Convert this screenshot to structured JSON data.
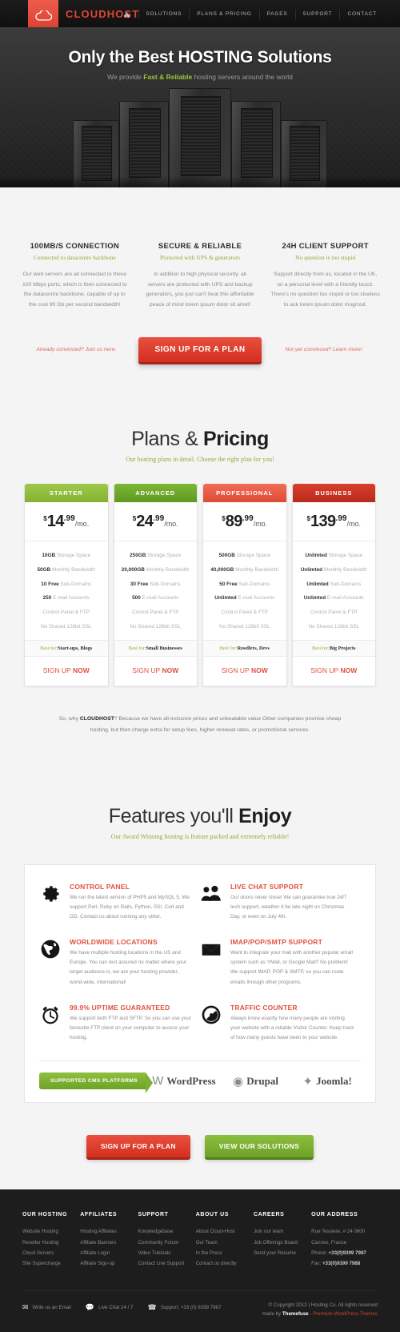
{
  "header": {
    "brand": "CLOUDHOST",
    "logo_icon": "cloud-icon",
    "home_icon": "home-icon",
    "nav": [
      {
        "label": "SOLUTIONS"
      },
      {
        "label": "PLANS & PRICING"
      },
      {
        "label": "PAGES"
      },
      {
        "label": "SUPPORT"
      },
      {
        "label": "CONTACT"
      }
    ]
  },
  "hero": {
    "title_light": "Only the Best ",
    "title_bold": "HOSTING Solutions",
    "sub_pre": "We provide ",
    "sub_hl": "Fast & Reliable",
    "sub_post": " hosting servers around the world"
  },
  "intro": {
    "columns": [
      {
        "title": "100MB/S CONNECTION",
        "tagline": "Connected to datacentre backbone",
        "body": "Our web servers are all connected to these 100 Mbps ports, which is then connected to the datacentre backbone, capable of up to the cool 90 Gb per second bandwidth!"
      },
      {
        "title": "SECURE & RELIABLE",
        "tagline": "Protected with UPS & generators",
        "body": "In addition to high physical security, all servers are protected with UPS and backup generators, you just can't beat this affordable peace of mind lorem ipsum dolor sit amet!"
      },
      {
        "title": "24H CLIENT SUPPORT",
        "tagline": "No question is too stupid",
        "body": "Support directly from us, located in the UK, on a personal level with a friendly touch. There's no question too stupid or too clueless to ask lorem ipsum dolor mogrosit."
      }
    ],
    "left_note": "Already convinced? Join us here:",
    "cta_label": "SIGN UP FOR A PLAN",
    "right_note": "Not yet convinced? Learn more!"
  },
  "plans": {
    "title_light": "Plans & ",
    "title_bold": "Pricing",
    "subtitle": "Our hosting plans in detail. Choose the right plan for you!",
    "items": [
      {
        "name": "STARTER",
        "currency": "$",
        "price": "14",
        "cents": ".99",
        "period": "/mo.",
        "features": [
          {
            "strong": "10GB",
            "rest": " Storage Space"
          },
          {
            "strong": "50GB",
            "rest": " Monthly Bandwidth"
          },
          {
            "strong": "10 Free",
            "rest": " Sub-Domains"
          },
          {
            "strong": "250",
            "rest": " E-mail Accounts"
          },
          {
            "strong": "",
            "rest": "Control Panel & FTP"
          },
          {
            "strong": "",
            "rest": "No Shared 128bit SSL"
          }
        ],
        "best_label": "Best for:",
        "best_value": "Start-ups, Blogs",
        "cta_light": "SIGN UP ",
        "cta_bold": "NOW"
      },
      {
        "name": "ADVANCED",
        "currency": "$",
        "price": "24",
        "cents": ".99",
        "period": "/mo.",
        "features": [
          {
            "strong": "250GB",
            "rest": " Storage Space"
          },
          {
            "strong": "20,000GB",
            "rest": " Monthly Bandwidth"
          },
          {
            "strong": "30 Free",
            "rest": " Sub-Domains"
          },
          {
            "strong": "500",
            "rest": " E-mail Accounts"
          },
          {
            "strong": "",
            "rest": "Control Panel & FTP"
          },
          {
            "strong": "",
            "rest": "No Shared 128bit SSL"
          }
        ],
        "best_label": "Best for:",
        "best_value": "Small Businesses",
        "cta_light": "SIGN UP ",
        "cta_bold": "NOW"
      },
      {
        "name": "PROFESSIONAL",
        "currency": "$",
        "price": "89",
        "cents": ".99",
        "period": "/mo.",
        "features": [
          {
            "strong": "500GB",
            "rest": " Storage Space"
          },
          {
            "strong": "40,000GB",
            "rest": " Monthly Bandwidth"
          },
          {
            "strong": "50 Free",
            "rest": " Sub-Domains"
          },
          {
            "strong": "Unlimted",
            "rest": " E-mail Accounts"
          },
          {
            "strong": "",
            "rest": "Control Panel & FTP"
          },
          {
            "strong": "",
            "rest": "No Shared 128bit SSL"
          }
        ],
        "best_label": "Best for:",
        "best_value": "Resellers, Devs",
        "cta_light": "SIGN UP ",
        "cta_bold": "NOW"
      },
      {
        "name": "BUSINESS",
        "currency": "$",
        "price": "139",
        "cents": ".99",
        "period": "/mo.",
        "features": [
          {
            "strong": "Unlimted",
            "rest": " Storage Space"
          },
          {
            "strong": "Unlimted",
            "rest": " Monthly Bandwidth"
          },
          {
            "strong": "Unlimted",
            "rest": " Sub-Domains"
          },
          {
            "strong": "Unlimted",
            "rest": " E-mail Accounts"
          },
          {
            "strong": "",
            "rest": "Control Panel & FTP"
          },
          {
            "strong": "",
            "rest": "No Shared 128bit SSL"
          }
        ],
        "best_label": "Best for:",
        "best_value": "Big Projects",
        "cta_light": "SIGN UP ",
        "cta_bold": "NOW"
      }
    ],
    "note_pre": "So, why ",
    "note_brand": "CLOUDHOST",
    "note_post": "? Because we have all-inclusive prices and unbeatable value Other companies promise cheap hosting, but then charge extra for setup fees, higher renewal rates, or promotional services."
  },
  "features": {
    "title_light": "Features you'll ",
    "title_bold": "Enjoy",
    "subtitle": "Our Award Winning hosting is feature packed and extremely reliable!",
    "items": [
      {
        "icon": "gear-icon",
        "title": "CONTROL PANEL",
        "body": "We run the latest version of PHP5 and MySQL 5. We support Perl, Ruby on Rails, Python, SSI, Curl and GD. Contact us about running any other."
      },
      {
        "icon": "people-chat-icon",
        "title": "LIVE CHAT SUPPORT",
        "body": "Our doors never close! We can guarantee true 24/7 tech support, weather it be late night on Christmas Day, or even on July 4th."
      },
      {
        "icon": "globe-icon",
        "title": "WORLDWIDE LOCATIONS",
        "body": "We have multiple hosting locations in the US and Europe. You can rest assured no matter where your target audience is, we are your hosting provider, world-wide, international!"
      },
      {
        "icon": "envelope-icon",
        "title": "IMAP/POP/SMTP SUPPORT",
        "body": "Want to integrate your mail with another popular email system such as YMail, or Google Mail? No problem! We support IMAP, POP & SMTP, so you can route emails through other programs."
      },
      {
        "icon": "alarm-clock-icon",
        "title": "99.9% UPTIME GUARANTEED",
        "body": "We support both FTP and SFTP. So you can use your favourite FTP client on your computer to access your hosting."
      },
      {
        "icon": "traffic-counter-icon",
        "title": "TRAFFIC COUNTER",
        "body": "Always know exactly how many people are visiting your website with a reliable Visitor Counter. Keep track of how many guests have been to your website."
      }
    ],
    "cms_badge": "SUPPORTED CMS PLATFORMS",
    "cms_platforms": [
      {
        "name": "WordPress",
        "mark": "W"
      },
      {
        "name": "Drupal",
        "mark": "◉"
      },
      {
        "name": "Joomla!",
        "mark": "✦"
      }
    ]
  },
  "bottom_cta": {
    "primary": "SIGN UP FOR A PLAN",
    "secondary": "VIEW OUR SOLUTIONS"
  },
  "footer": {
    "columns": [
      {
        "title": "OUR HOSTING",
        "links": [
          "Website Hosting",
          "Reseller Hosting",
          "Cloud Servers",
          "Site Supercharge"
        ]
      },
      {
        "title": "AFFILIATES",
        "links": [
          "Hosting Affiliates",
          "Affiliate Banners",
          "Affiliate Login",
          "Affiliate Sign-up"
        ]
      },
      {
        "title": "SUPPORT",
        "links": [
          "Knowledgebase",
          "Community Forum",
          "Video Tutorials",
          "Contact Live Support"
        ]
      },
      {
        "title": "ABOUT US",
        "links": [
          "About Cloud-Host",
          "Our Team",
          "In the Press",
          "Contact us directly"
        ]
      },
      {
        "title": "CAREERS",
        "links": [
          "Join our team",
          "Job Offerings Board",
          "Send your Resume"
        ]
      }
    ],
    "address": {
      "title": "OUR ADDRESS",
      "line1": "Rue Tessiere, # 24 0600",
      "line2": "Cannes, France",
      "phone_label": "Phone: ",
      "phone_value": "+33(0)9399 7987",
      "fax_label": "Fax: ",
      "fax_value": "+33(0)9399 7988"
    },
    "contacts": [
      {
        "icon": "envelope-icon",
        "label": "Write us an Email"
      },
      {
        "icon": "chat-bubble-icon",
        "label": "Live Chat 24 / 7"
      },
      {
        "icon": "headset-icon",
        "label": "Support: +33 (0) 9399 7987"
      }
    ],
    "copyright": "© Copyright 2012 | Hosting Co. All rights reserved",
    "made_pre": "made by ",
    "made_brand": "Themefuse",
    "made_sep": " - ",
    "made_link": "Premium WordPress Themes"
  }
}
